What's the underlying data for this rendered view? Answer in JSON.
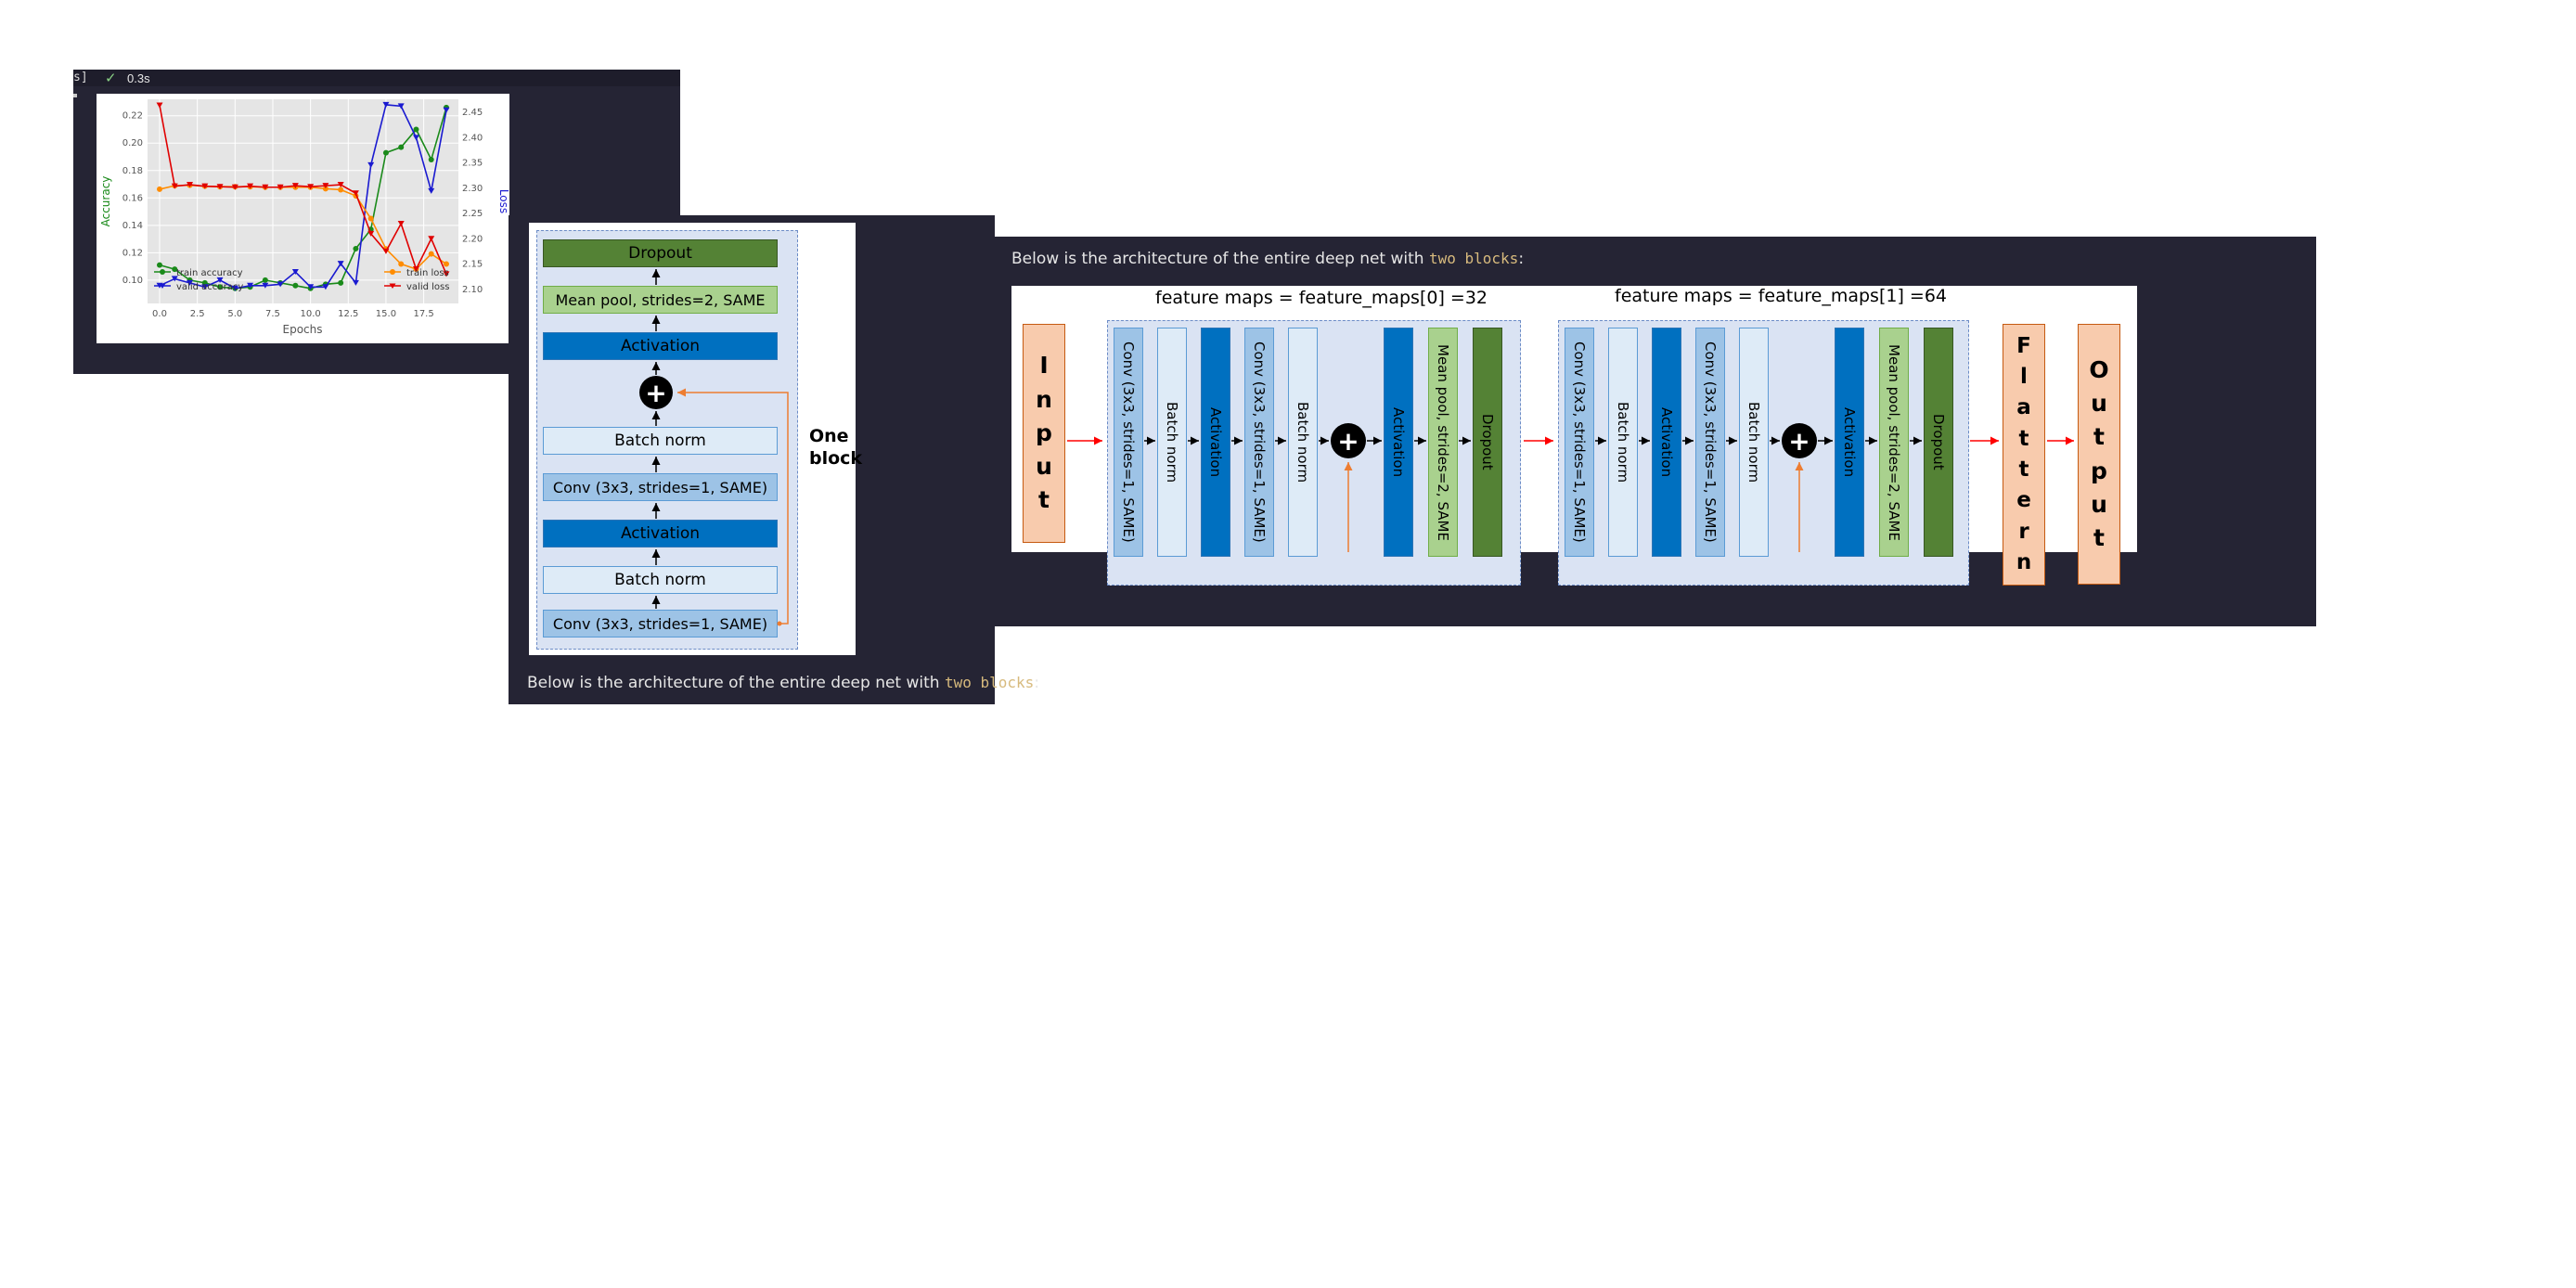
{
  "cell1": {
    "exec_count": "s]",
    "status_icon": "check-icon",
    "exec_time": "0.3s",
    "chart_data": {
      "type": "line",
      "xlabel": "Epochs",
      "ylabel_left": "Accuracy",
      "ylabel_right": "Loss",
      "x": [
        0,
        1,
        2,
        3,
        4,
        5,
        6,
        7,
        8,
        9,
        10,
        11,
        12,
        13,
        14,
        15,
        16,
        17,
        18,
        19
      ],
      "xticks": [
        "0.0",
        "2.5",
        "5.0",
        "7.5",
        "10.0",
        "12.5",
        "15.0",
        "17.5"
      ],
      "ylim_left": [
        0.083,
        0.232
      ],
      "yticks_left": [
        "0.10",
        "0.12",
        "0.14",
        "0.16",
        "0.18",
        "0.20",
        "0.22"
      ],
      "ylim_right": [
        2.072,
        2.476
      ],
      "yticks_right": [
        "2.10",
        "2.15",
        "2.20",
        "2.25",
        "2.30",
        "2.35",
        "2.40",
        "2.45"
      ],
      "grid": true,
      "series": [
        {
          "name": "train accuracy",
          "axis": "left",
          "color": "#1a8a1a",
          "marker": "circle",
          "values": [
            0.111,
            0.108,
            0.1,
            0.098,
            0.095,
            0.094,
            0.095,
            0.1,
            0.098,
            0.096,
            0.094,
            0.097,
            0.098,
            0.123,
            0.137,
            0.193,
            0.197,
            0.21,
            0.188,
            0.226
          ]
        },
        {
          "name": "valid accuracy",
          "axis": "left",
          "color": "#1a1ad0",
          "marker": "triangle-down",
          "values": [
            0.096,
            0.101,
            0.098,
            0.095,
            0.1,
            0.094,
            0.096,
            0.096,
            0.097,
            0.106,
            0.095,
            0.095,
            0.112,
            0.098,
            0.184,
            0.228,
            0.227,
            0.204,
            0.165,
            0.224
          ]
        },
        {
          "name": "train loss",
          "axis": "right",
          "color": "#ff8c00",
          "marker": "circle",
          "values": [
            2.298,
            2.305,
            2.306,
            2.304,
            2.303,
            2.303,
            2.303,
            2.302,
            2.302,
            2.302,
            2.302,
            2.299,
            2.297,
            2.285,
            2.24,
            2.18,
            2.15,
            2.14,
            2.17,
            2.15
          ]
        },
        {
          "name": "valid loss",
          "axis": "right",
          "color": "#e00000",
          "marker": "triangle-down",
          "values": [
            2.464,
            2.304,
            2.307,
            2.304,
            2.303,
            2.302,
            2.304,
            2.302,
            2.302,
            2.305,
            2.303,
            2.305,
            2.307,
            2.29,
            2.21,
            2.175,
            2.23,
            2.14,
            2.2,
            2.13
          ]
        }
      ],
      "legend_left": [
        "train accuracy",
        "valid accuracy"
      ],
      "legend_right": [
        "train loss",
        "valid loss"
      ]
    }
  },
  "block": {
    "layers": [
      "Dropout",
      "Mean pool, strides=2, SAME",
      "Activation",
      "Batch norm",
      "Conv (3x3, strides=1, SAME)",
      "Activation",
      "Batch norm",
      "Conv (3x3, strides=1, SAME)"
    ],
    "plus": "+",
    "label_line1": "One",
    "label_line2": "block"
  },
  "caption_cell2": {
    "prefix": "Below is the architecture of the entire deep net with ",
    "code": "two blocks",
    "suffix": ":"
  },
  "caption_cell3": {
    "prefix": "Below is the architecture of the entire deep net with ",
    "code": "two blocks",
    "suffix": ":"
  },
  "net": {
    "input_letters": [
      "I",
      "n",
      "p",
      "u",
      "t"
    ],
    "flatten_letters": [
      "F",
      "l",
      "a",
      "t",
      "t",
      "e",
      "r",
      "n"
    ],
    "output_letters": [
      "O",
      "u",
      "t",
      "p",
      "u",
      "t"
    ],
    "block1_title": "feature maps = feature_maps[0] =32",
    "block2_title": "feature maps = feature_maps[1] =64",
    "layers": [
      "Conv (3x3, strides=1, SAME)",
      "Batch norm",
      "Activation",
      "Conv (3x3, strides=1, SAME)",
      "Batch norm",
      "Activation",
      "Mean pool, strides=2, SAME",
      "Dropout"
    ],
    "plus": "+"
  },
  "colors": {
    "conv": "#9dc3e6",
    "batch_norm": "#deebf7",
    "activation": "#0070c0",
    "pool": "#a9d18e",
    "dropout": "#548235",
    "io": "#f8cbad",
    "cell_bg": "#252434",
    "skip_arrow": "#ed7d31",
    "flow_arrow": "#ff0000"
  }
}
